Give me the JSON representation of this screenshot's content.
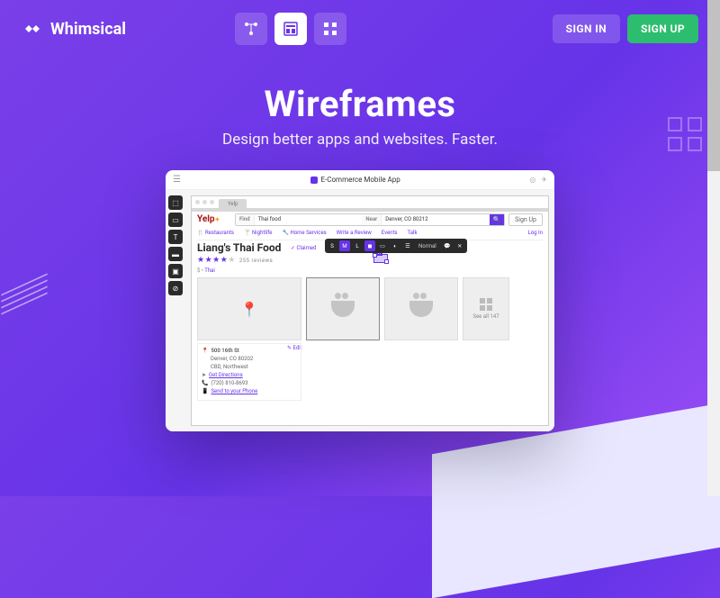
{
  "logo": {
    "text": "Whimsical"
  },
  "auth": {
    "signin": "SIGN IN",
    "signup": "SIGN UP"
  },
  "hero": {
    "title": "Wireframes",
    "subtitle": "Design better apps and websites. Faster."
  },
  "editor": {
    "title": "E-Commerce Mobile App",
    "wire_tab": "Yelp",
    "brand": "Yelp",
    "search": {
      "find_label": "Find",
      "find_value": "Thai food",
      "near_label": "Near",
      "near_value": "Denver, CO 80212"
    },
    "signup_btn": "Sign Up",
    "login": "Log In",
    "menu": {
      "m1": "Restaurants",
      "m2": "Nightlife",
      "m3": "Home Services",
      "m4": "Write a Review",
      "m5": "Events",
      "m6": "Talk"
    },
    "biz_name": "Liang's Thai Food",
    "claimed": "✓ Claimed",
    "reviews": "255 reviews",
    "price_cat": "$ •",
    "cat_link": "Thai",
    "sel_label": "W",
    "see_all": "See all 147",
    "float": {
      "s": "S",
      "m": "M",
      "l": "L",
      "normal": "Normal"
    },
    "info": {
      "addr1": "500 16th St",
      "addr2": "Denver, CO 80202",
      "addr3": "CBD, Northwest",
      "dir": "Get Directions",
      "phone": "(720) 810-8693",
      "send": "Send to your Phone",
      "edit": "✎ Edit"
    }
  }
}
